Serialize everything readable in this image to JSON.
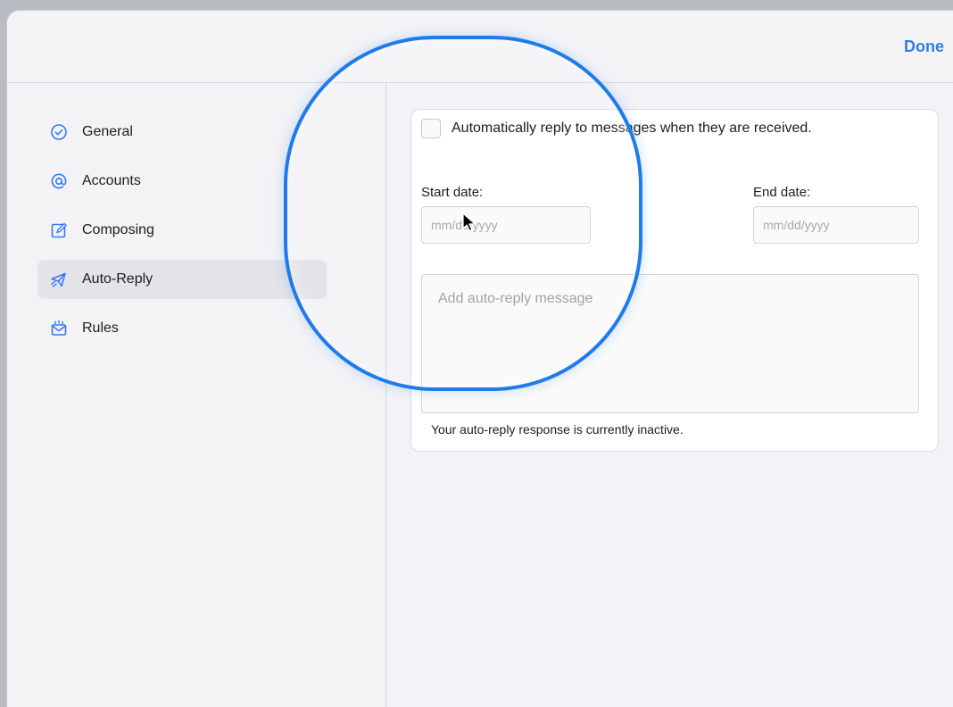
{
  "toolbar": {
    "done_label": "Done"
  },
  "sidebar": {
    "items": [
      {
        "label": "General",
        "icon": "check-circle-icon",
        "active": false
      },
      {
        "label": "Accounts",
        "icon": "at-sign-icon",
        "active": false
      },
      {
        "label": "Composing",
        "icon": "compose-icon",
        "active": false
      },
      {
        "label": "Auto-Reply",
        "icon": "airplane-icon",
        "active": true
      },
      {
        "label": "Rules",
        "icon": "mail-rules-icon",
        "active": false
      }
    ]
  },
  "autoreply": {
    "checkbox_label": "Automatically reply to messages when they are received.",
    "checkbox_checked": false,
    "start_date_label": "Start date:",
    "start_date_placeholder": "mm/dd/yyyy",
    "end_date_label": "End date:",
    "end_date_placeholder": "mm/dd/yyyy",
    "message_placeholder": "Add auto-reply message",
    "status_text": "Your auto-reply response is currently inactive."
  },
  "colors": {
    "accent": "#2f7ee0",
    "magnifier_ring": "#1f7bea",
    "icon_blue": "#3478f6"
  }
}
